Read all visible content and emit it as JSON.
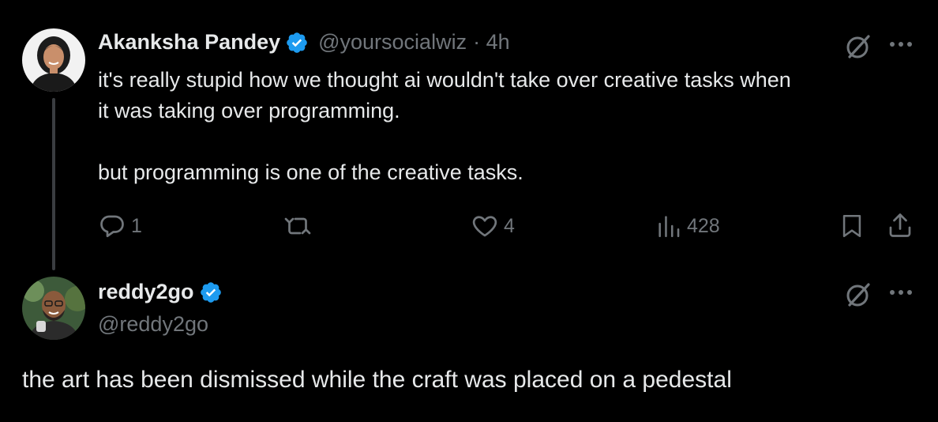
{
  "tweet1": {
    "author_name": "Akanksha Pandey",
    "handle": "@yoursocialwiz",
    "time": "· 4h",
    "text_line1": "it's really stupid how we thought ai wouldn't take over creative tasks when",
    "text_line2": "it was taking over programming.",
    "text_line3": "but programming is one of the creative tasks.",
    "actions": {
      "reply_count": "1",
      "like_count": "4",
      "views_count": "428"
    }
  },
  "tweet2": {
    "author_name": "reddy2go",
    "handle": "@reddy2go",
    "text": "the art has been dismissed while the craft was placed on a pedestal"
  },
  "colors": {
    "background": "#000000",
    "text": "#e7e9ea",
    "muted": "#71767b",
    "verified": "#1d9bf0",
    "thread_line": "#3a3d41"
  },
  "icons": [
    "verified-badge-icon",
    "grok-icon",
    "more-icon",
    "reply-icon",
    "repost-icon",
    "like-icon",
    "views-icon",
    "bookmark-icon",
    "share-icon"
  ]
}
